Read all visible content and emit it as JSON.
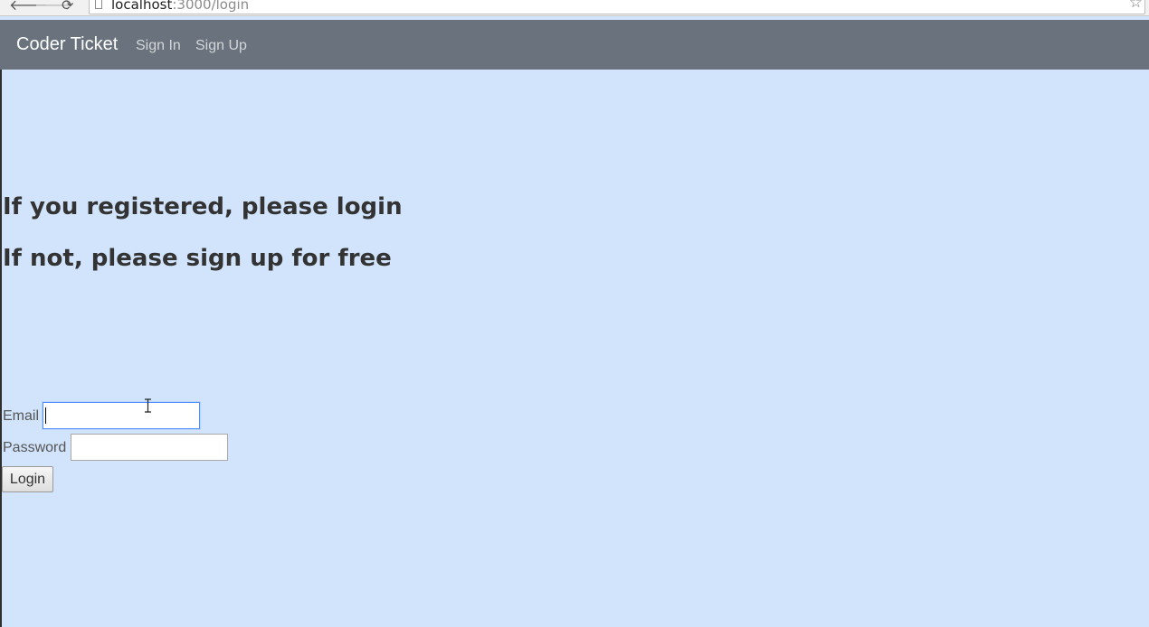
{
  "browser": {
    "url_host": "localhost",
    "url_path": ":3000/login",
    "back_glyph": "🡐",
    "forward_glyph": "🡒",
    "reload_glyph": "⟳",
    "star_glyph": "☆"
  },
  "navbar": {
    "brand": "Coder Ticket",
    "links": [
      {
        "label": "Sign In"
      },
      {
        "label": "Sign Up"
      }
    ]
  },
  "main": {
    "heading_1": "If you registered, please login",
    "heading_2": "If not, please sign up for free"
  },
  "login_form": {
    "email_label": "Email",
    "email_value": "",
    "password_label": "Password",
    "password_value": "",
    "submit_label": "Login"
  },
  "colors": {
    "page_background": "#d1e4fc",
    "navbar_background": "#6a737d",
    "heading_text": "#333333",
    "focus_ring": "#4d90fe"
  }
}
